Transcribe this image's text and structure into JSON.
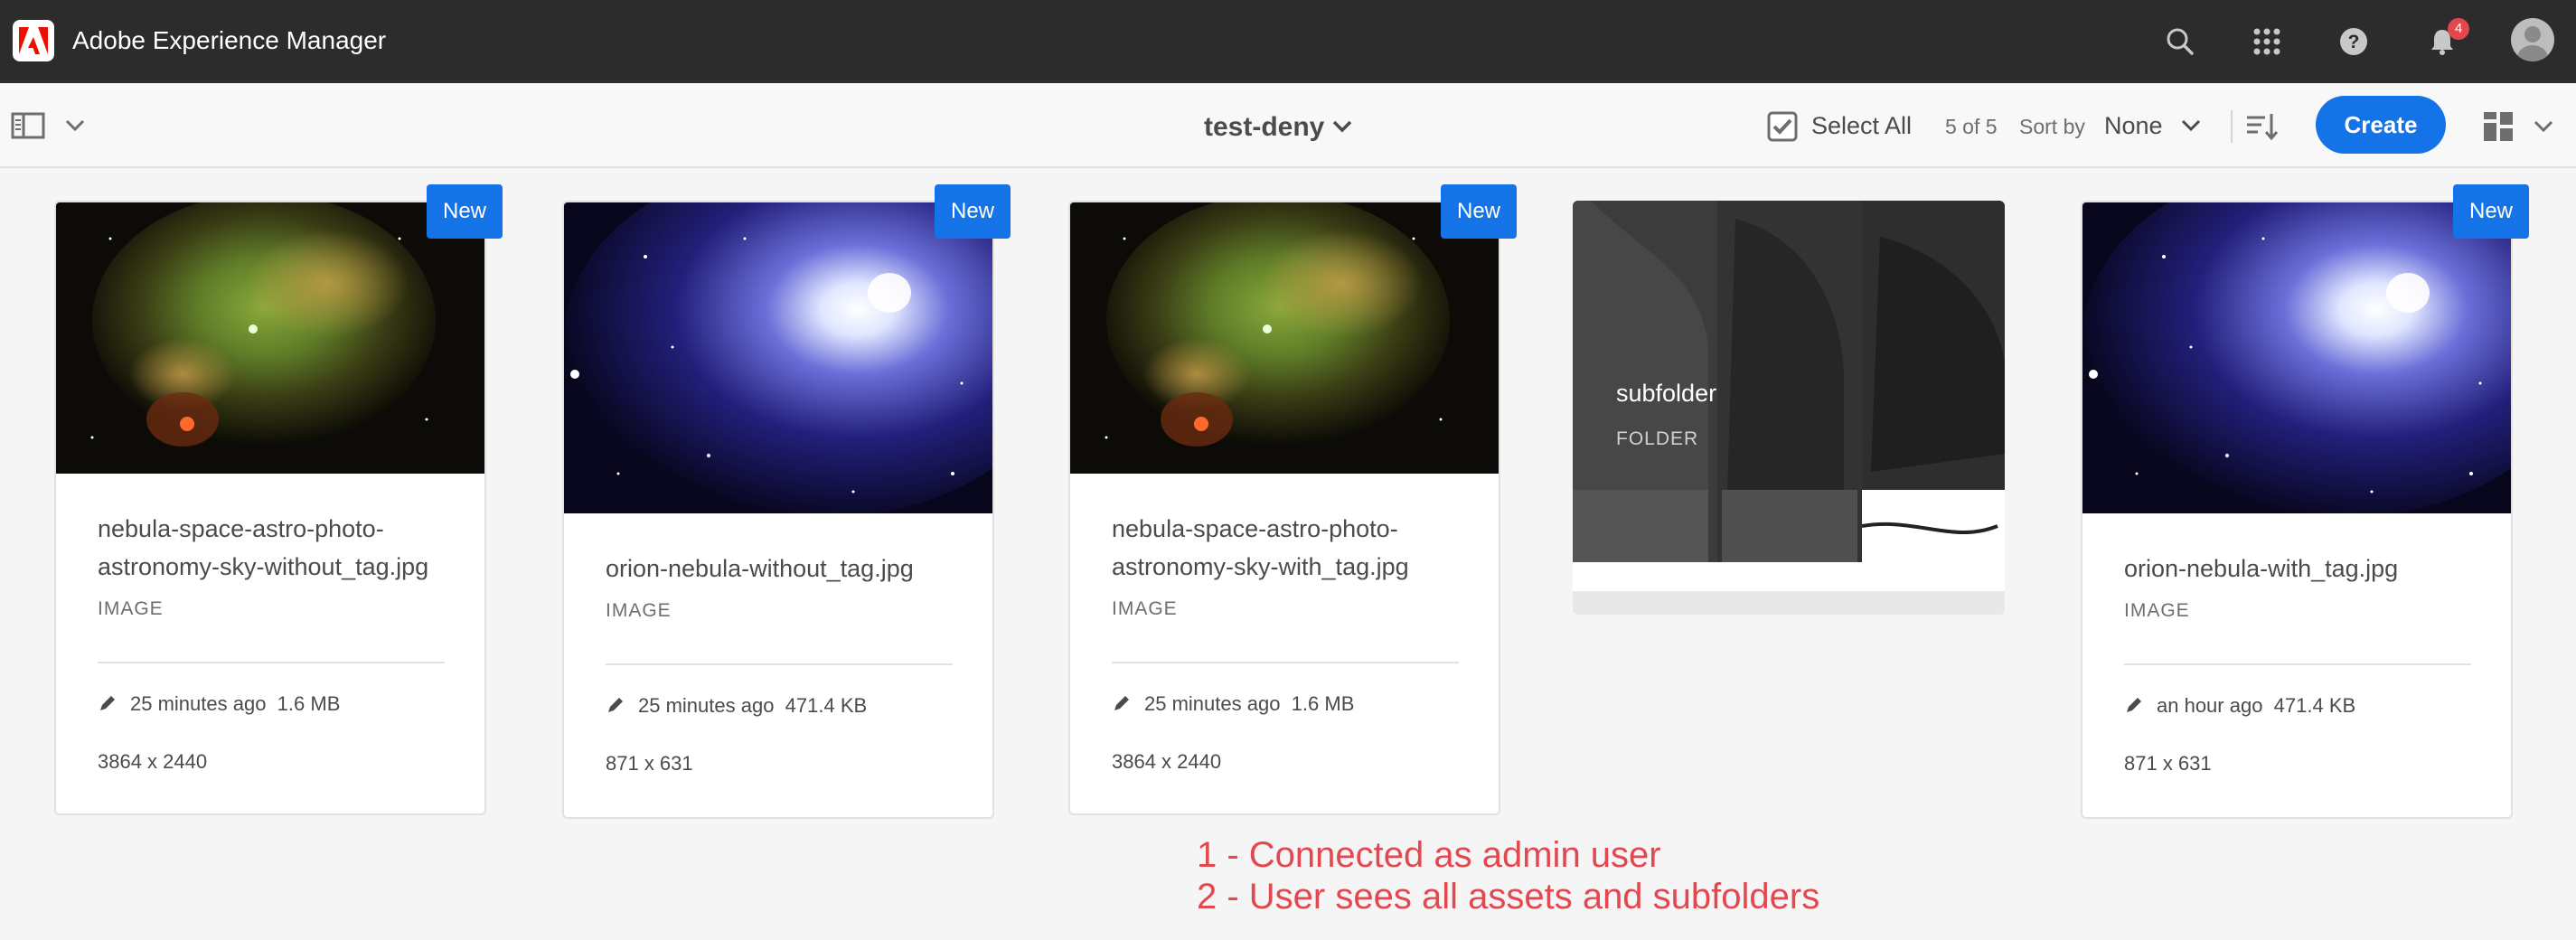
{
  "shell": {
    "app_title": "Adobe Experience Manager",
    "notification_count": "4",
    "icons": [
      "adobe-logo-icon",
      "search-icon",
      "apps-grid-icon",
      "help-icon",
      "bell-icon",
      "user-avatar"
    ]
  },
  "actionbar": {
    "folder_title": "test-deny",
    "select_all_label": "Select All",
    "item_count": "5 of 5",
    "sort_label": "Sort by",
    "sort_value": "None",
    "create_label": "Create"
  },
  "cards": [
    {
      "title_line1": "nebula-space-astro-photo-",
      "title_line2": "astronomy-sky-without_tag.jpg",
      "type": "IMAGE",
      "modified": "25 minutes ago",
      "size": "1.6 MB",
      "dimensions": "3864 x 2440",
      "badge": "New"
    },
    {
      "title_line1": "orion-nebula-without_tag.jpg",
      "type": "IMAGE",
      "modified": "25 minutes ago",
      "size": "471.4 KB",
      "dimensions": "871 x 631",
      "badge": "New"
    },
    {
      "title_line1": "nebula-space-astro-photo-",
      "title_line2": "astronomy-sky-with_tag.jpg",
      "type": "IMAGE",
      "modified": "25 minutes ago",
      "size": "1.6 MB",
      "dimensions": "3864 x 2440",
      "badge": "New"
    },
    {
      "title_line1": "subfolder",
      "type": "FOLDER"
    },
    {
      "title_line1": "orion-nebula-with_tag.jpg",
      "type": "IMAGE",
      "modified": "an hour ago",
      "size": "471.4 KB",
      "dimensions": "871 x 631",
      "badge": "New"
    }
  ],
  "annotations": {
    "line1": "1 - Connected as admin user",
    "line2": "2 - User sees all assets and subfolders"
  },
  "colors": {
    "shell_bg": "#2c2c2c",
    "accent": "#1473e6",
    "annotation": "#e34850"
  }
}
